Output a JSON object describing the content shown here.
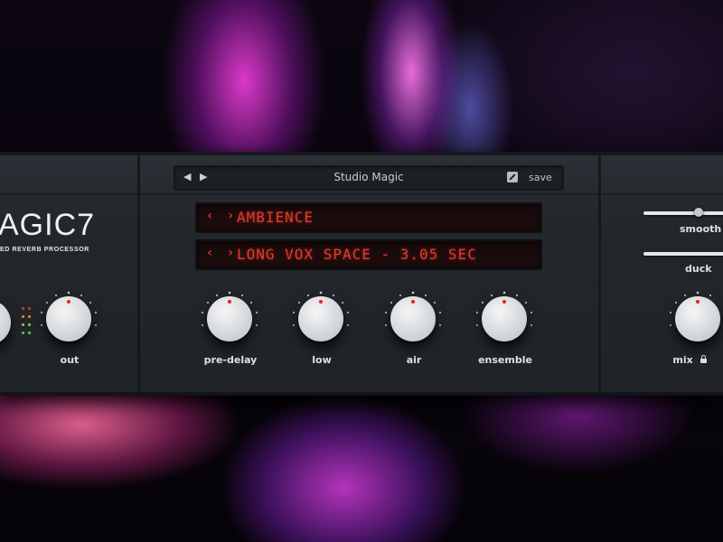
{
  "plugin": {
    "logo_text": "AGIC7",
    "logo_subtitle": "ED REVERB PROCESSOR"
  },
  "preset": {
    "name": "Studio Magic",
    "prev_icon": "◀",
    "next_icon": "▶",
    "save_label": "save"
  },
  "displays": {
    "category": {
      "nav": "‹ ›",
      "text": "AMBIENCE"
    },
    "program": {
      "nav": "‹ ›",
      "text": "LONG VOX SPACE - 3.05 SEC"
    }
  },
  "knobs": {
    "out": "out",
    "pre_delay": "pre-delay",
    "low": "low",
    "air": "air",
    "ensemble": "ensemble",
    "mix": "mix"
  },
  "sliders": {
    "smooth": {
      "label": "smooth",
      "value_fraction": 0.78
    },
    "duck": {
      "label": "duck",
      "value_fraction": 1.0
    }
  },
  "colors": {
    "accent": "#e03b2c",
    "panel": "#25292e",
    "knob": "#d6d9dc"
  }
}
